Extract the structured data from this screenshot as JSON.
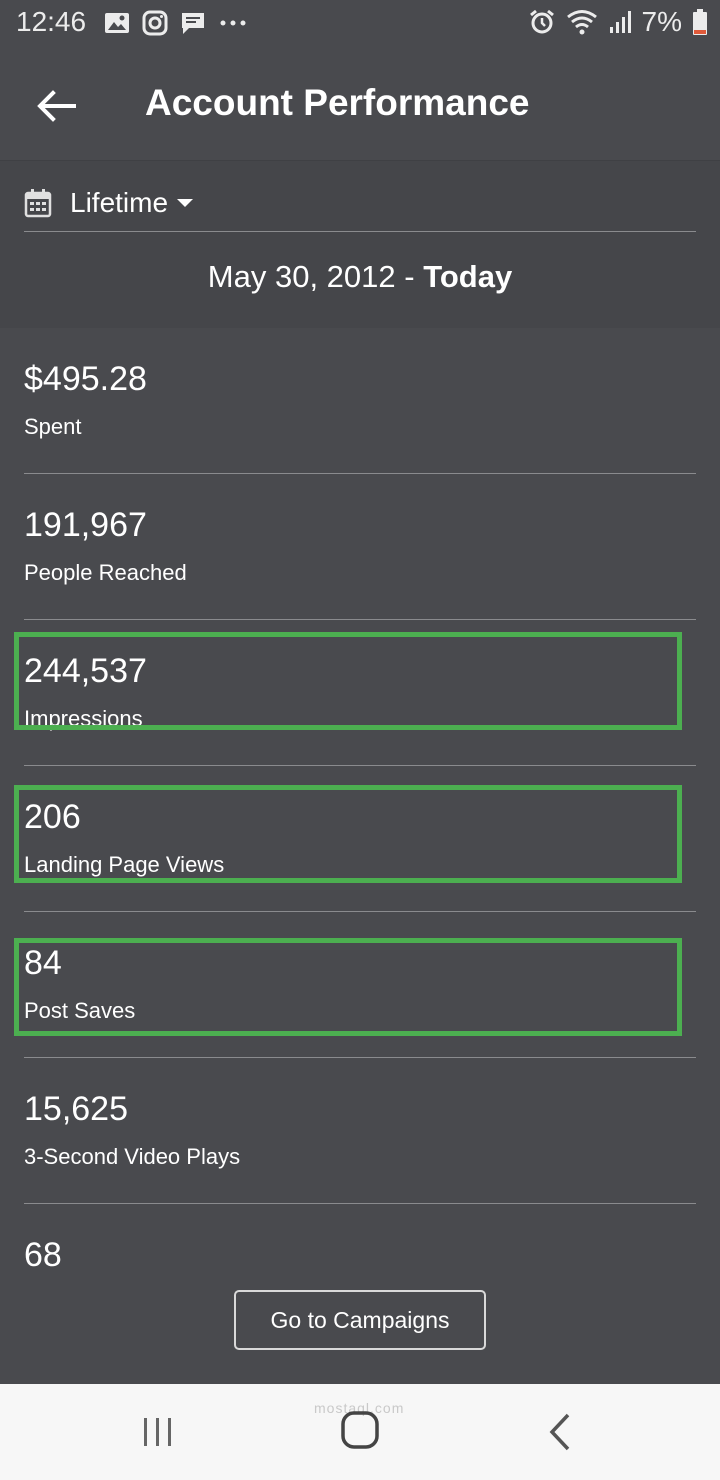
{
  "status_bar": {
    "time": "12:46",
    "battery": "7%",
    "icons": [
      "gallery-icon",
      "instagram-icon",
      "message-icon",
      "more-icon",
      "alarm-icon",
      "wifi-icon",
      "signal-icon",
      "battery-icon"
    ],
    "battery_color": "#e05a3a"
  },
  "app_bar": {
    "title": "Account Performance",
    "back_icon": "arrow-left-icon"
  },
  "range": {
    "selector_label": "Lifetime",
    "start": "May 30, 2012 - ",
    "end": "Today"
  },
  "metrics": [
    {
      "value": "$495.28",
      "label": "Spent"
    },
    {
      "value": "191,967",
      "label": "People Reached"
    },
    {
      "value": "244,537",
      "label": "Impressions"
    },
    {
      "value": "206",
      "label": "Landing Page Views"
    },
    {
      "value": "84",
      "label": "Post Saves"
    },
    {
      "value": "15,625",
      "label": "3-Second Video Plays"
    },
    {
      "value": "68",
      "label": ""
    }
  ],
  "highlight_color": "#4caf50",
  "cta": {
    "label": "Go to Campaigns"
  },
  "watermark": "mostaql.com"
}
